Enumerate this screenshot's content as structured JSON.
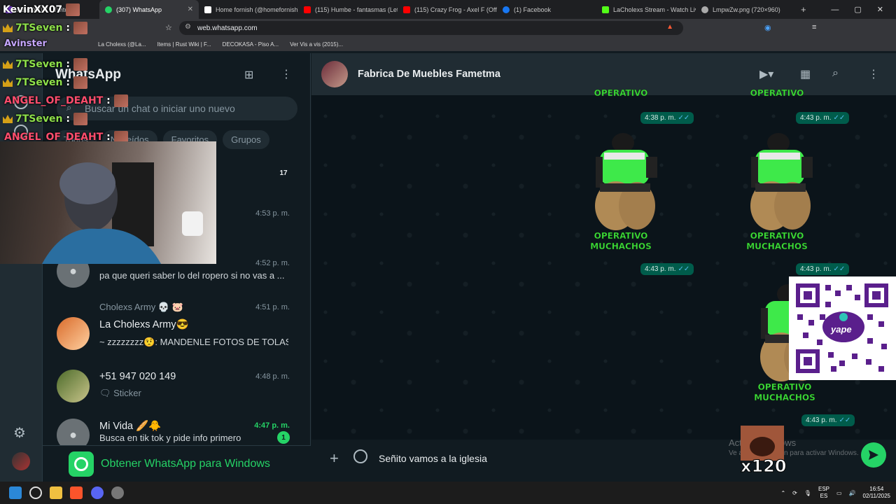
{
  "browser": {
    "tabs": [
      {
        "label": "KevinXX07 - Twitch",
        "icon_color": "#9146ff"
      },
      {
        "label": "(307) WhatsApp",
        "icon_color": "#25d366",
        "active": true
      },
      {
        "label": "Home fornish (@homefornish)",
        "icon_color": "#ffffff"
      },
      {
        "label": "(115) Humbe - fantasmas (Letr",
        "icon_color": "#ff0000"
      },
      {
        "label": "(115) Crazy Frog - Axel F (Offic",
        "icon_color": "#ff0000"
      },
      {
        "label": "(1) Facebook",
        "icon_color": "#1877f2"
      },
      {
        "label": "LaCholexs Stream - Watch Live",
        "icon_color": "#53fc18"
      },
      {
        "label": "LmpwZw.png (720×960)",
        "icon_color": "#aaaaaa"
      }
    ],
    "new_tab": "+",
    "window_controls": [
      "—",
      "▢",
      "✕"
    ],
    "url": "web.whatsapp.com",
    "bookmarks": [
      "La Cholexs (@La...",
      "Items | Rust Wiki | F...",
      "DECOKASA - Piso A...",
      "Ver Vis a vis (2015)..."
    ]
  },
  "whatsapp": {
    "title": "WhatsApp",
    "search_placeholder": "Buscar un chat o iniciar uno nuevo",
    "filters": [
      "Todos",
      "No leídos",
      "Favoritos",
      "Grupos"
    ],
    "chats": [
      {
        "name": "",
        "time": "",
        "preview": "",
        "badge": "17"
      },
      {
        "name": "",
        "time": "4:53 p. m.",
        "preview": ""
      },
      {
        "name": "",
        "time": "4:52 p. m.",
        "preview": "pa que queri saber lo del ropero si no vas a ..."
      },
      {
        "name": "La Cholexs Army😎",
        "group_label": "Cholexs Army 💀 🐷",
        "time": "4:51 p. m.",
        "preview": "~ zzzzzzzz🤨: MANDENLE FOTOS DE TOLAS ..."
      },
      {
        "name": "+51 947 020 149",
        "time": "4:48 p. m.",
        "preview": "Sticker"
      },
      {
        "name": "Mi Vida 🥖🐥",
        "time": "4:47 p. m.",
        "preview": "Busca en tik tok y pide info primero",
        "badge": "1",
        "unread": true
      }
    ],
    "get_app": "Obtener WhatsApp para Windows",
    "conversation": {
      "contact": "Fabrica De Muebles Fametma",
      "stickers": [
        {
          "caption": "OPERATIVO MUCHACHOS",
          "time": "4:38 p. m."
        },
        {
          "caption": "OPERATIVO MUCHACHOS",
          "time": "4:43 p. m."
        },
        {
          "caption": "OPERATIVO MUCHACHOS",
          "time": "4:43 p. m."
        },
        {
          "caption": "OPERATIVO MUCHACHOS",
          "time": "4:43 p. m."
        },
        {
          "caption": "OPERATIVO MUCHACHOS",
          "time": "4:43 p. m."
        }
      ],
      "composer_text": "Señito vamos a la iglesia"
    }
  },
  "stream_overlay": {
    "chat": [
      {
        "user": "KevinXX07",
        "color": "#ffffff",
        "text": ""
      },
      {
        "user": "7TSeven",
        "color": "#8ee04a",
        "text": ":"
      },
      {
        "user": "Avinster",
        "color": "#c7a7ff",
        "text": ""
      },
      {
        "user": "7TSeven",
        "color": "#8ee04a",
        "text": ":"
      },
      {
        "user": "7TSeven",
        "color": "#8ee04a",
        "text": ":"
      },
      {
        "user": "ANGEL_OF_DEAHT",
        "color": "#ff4d6d",
        "text": ":"
      },
      {
        "user": "7TSeven",
        "color": "#8ee04a",
        "text": ":"
      },
      {
        "user": "ANGEL_OF_DEAHT",
        "color": "#ff4d6d",
        "text": ":"
      }
    ],
    "gift_count": "x120",
    "yape_label": "yape"
  },
  "windows": {
    "activate_title": "Activar Windows",
    "activate_sub": "Ve a Configuración para activar Windows.",
    "lang_top": "ESP",
    "lang_bottom": "ES",
    "time": "16:54",
    "date": "02/11/2025"
  }
}
